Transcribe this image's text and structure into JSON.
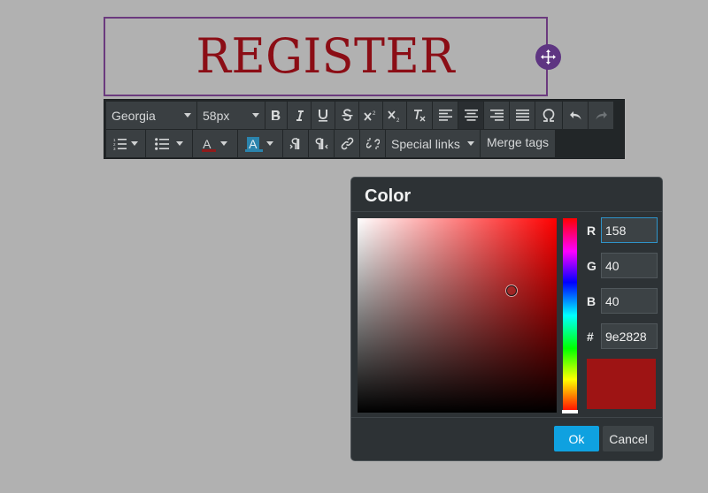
{
  "heading": {
    "text": "REGISTER"
  },
  "toolbar": {
    "font_family": "Georgia",
    "font_size": "58px",
    "special_links": "Special links",
    "merge_tags": "Merge tags",
    "font_color_letter": "A",
    "highlight_letter": "A"
  },
  "color_dialog": {
    "title": "Color",
    "r_label": "R",
    "g_label": "G",
    "b_label": "B",
    "hex_label": "#",
    "r_value": "158",
    "g_value": "40",
    "b_value": "40",
    "hex_value": "9e2828",
    "ok_label": "Ok",
    "cancel_label": "Cancel",
    "preview_color": "#9e1414"
  },
  "colors": {
    "accent": "#0fa1e0",
    "heading_color": "#8b0d15",
    "handle_color": "#5e3582"
  }
}
